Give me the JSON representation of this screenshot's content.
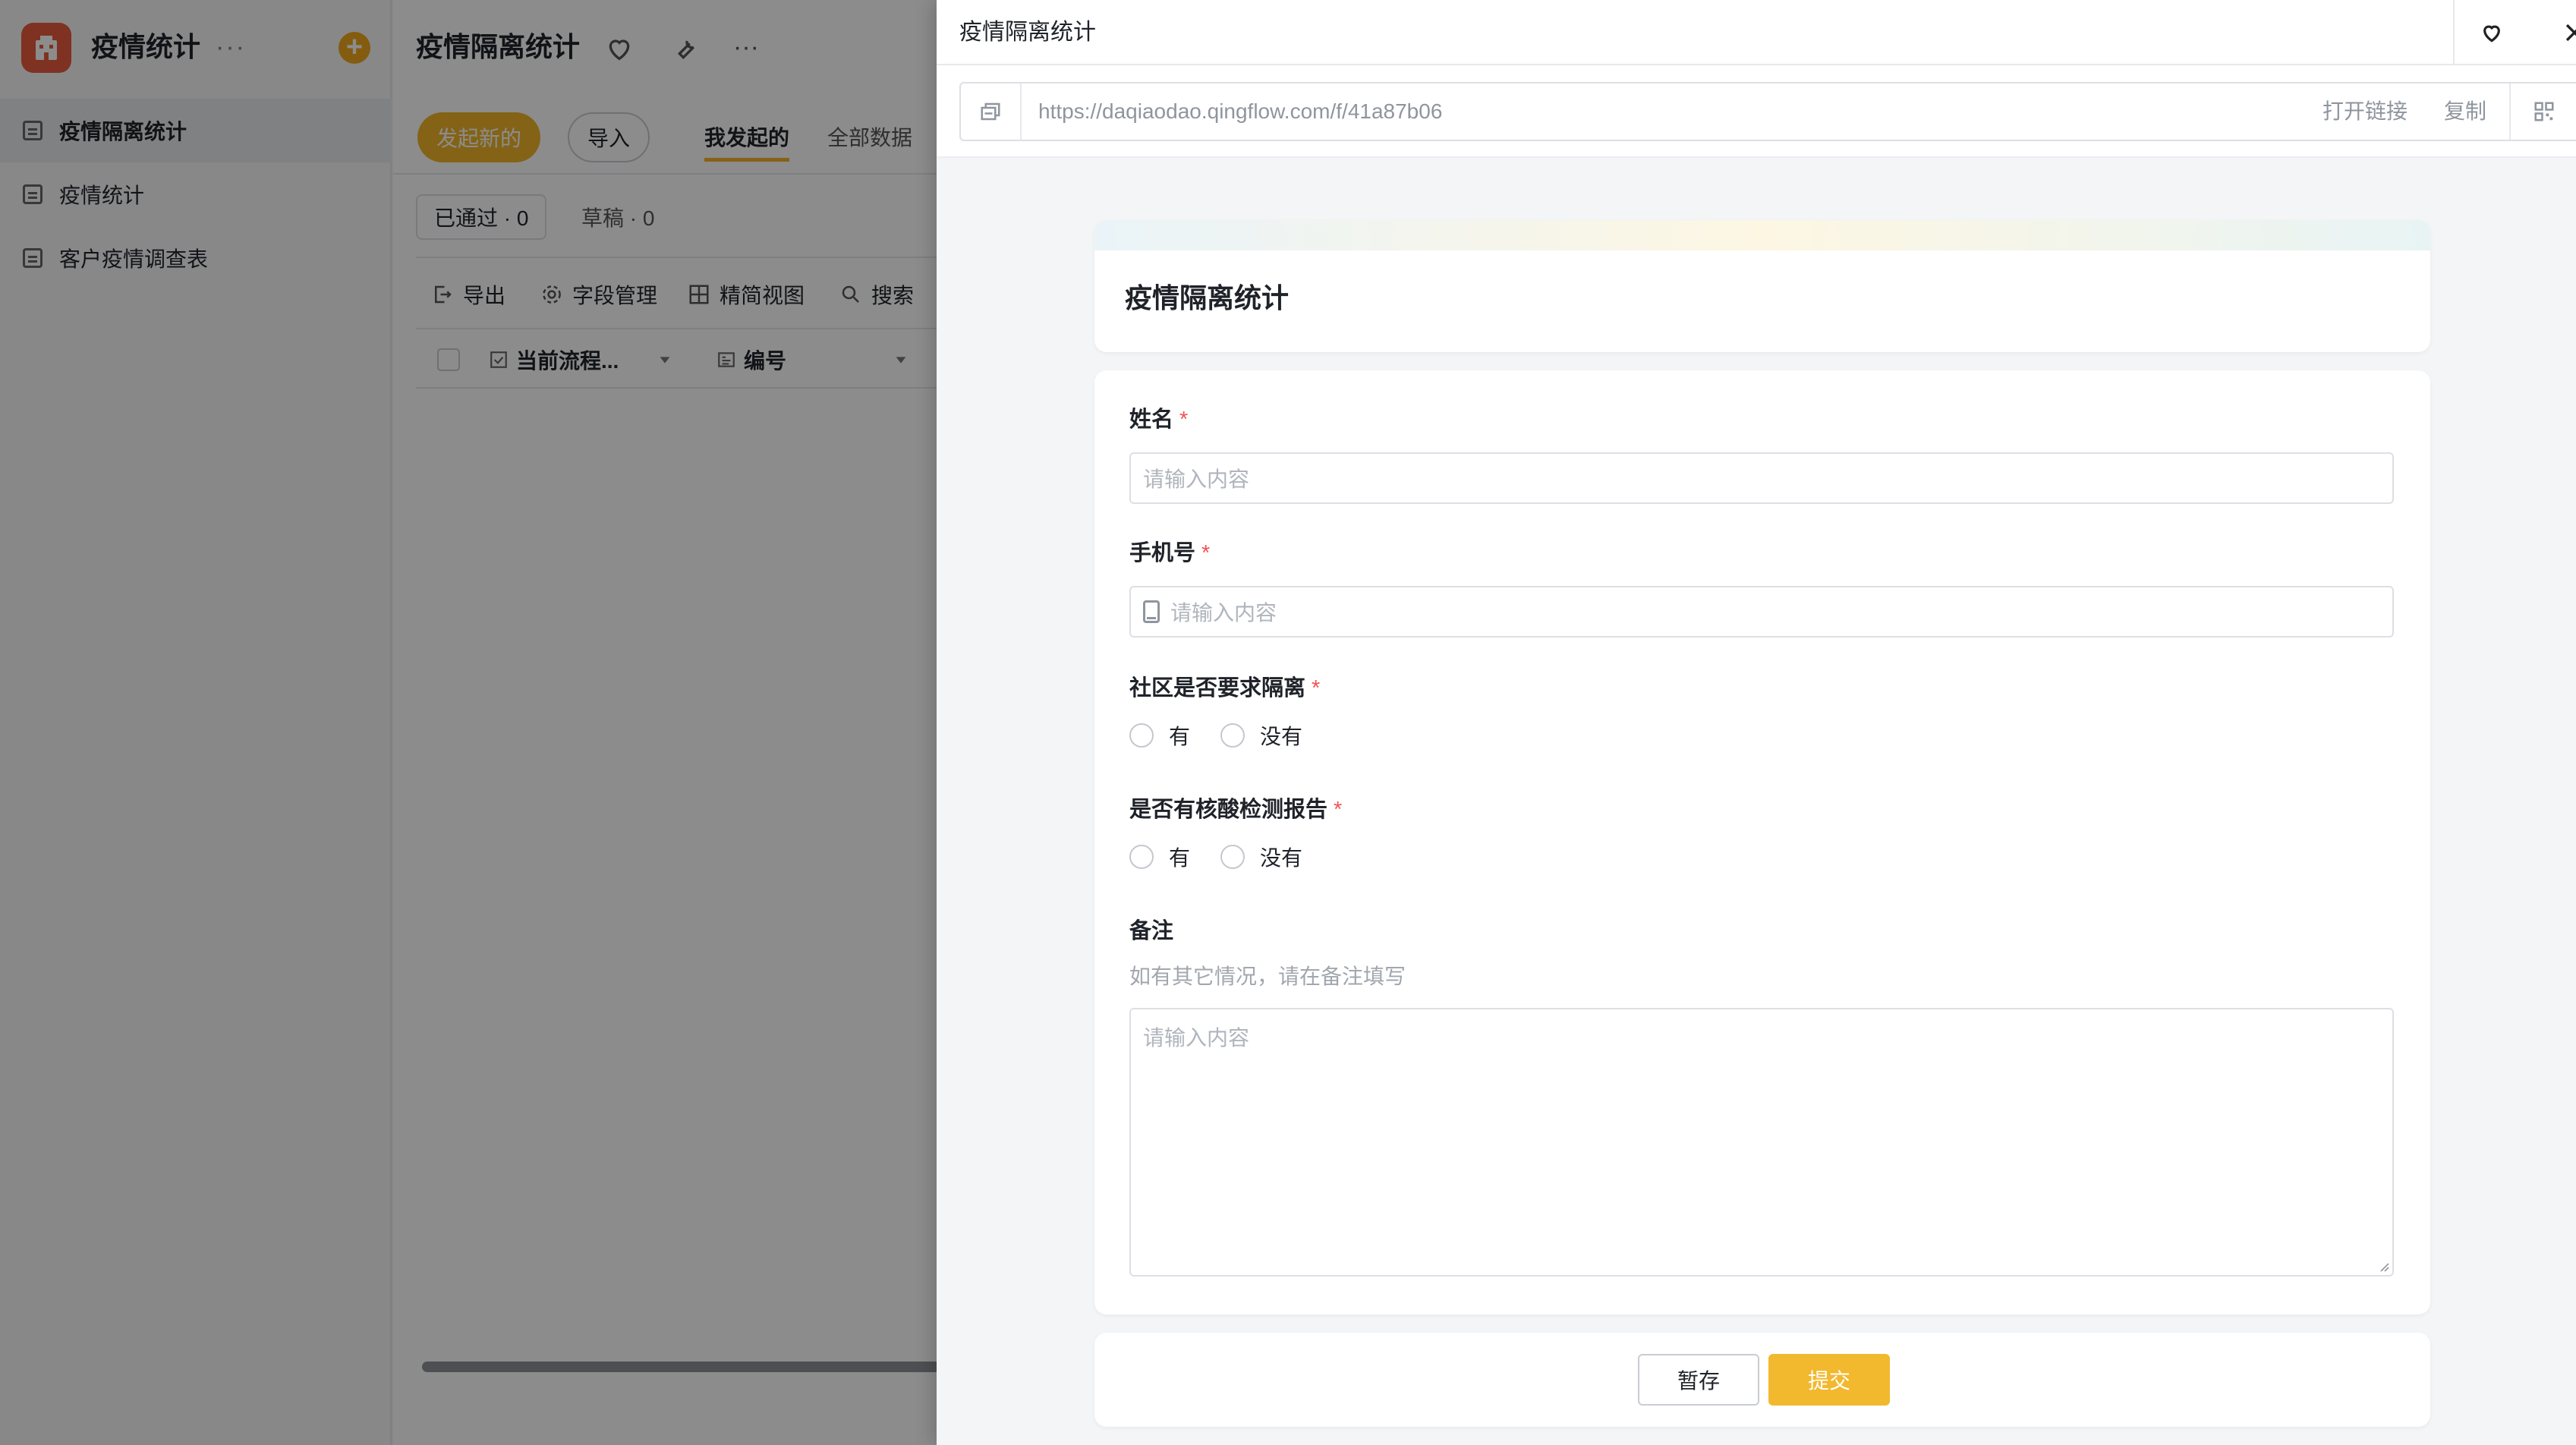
{
  "app": {
    "name": "疫情统计",
    "more": "···",
    "add": "+"
  },
  "sidebar": {
    "items": [
      {
        "label": "疫情隔离统计"
      },
      {
        "label": "疫情统计"
      },
      {
        "label": "客户疫情调查表"
      }
    ]
  },
  "main": {
    "title": "疫情隔离统计",
    "new_label": "发起新的",
    "import_label": "导入",
    "tabs": [
      {
        "label": "我发起的"
      },
      {
        "label": "全部数据"
      }
    ],
    "chips": [
      {
        "label": "已通过 · 0"
      },
      {
        "label": "草稿 · 0"
      }
    ],
    "toolbar": [
      {
        "label": "导出"
      },
      {
        "label": "字段管理"
      },
      {
        "label": "精简视图"
      },
      {
        "label": "搜索"
      }
    ],
    "columns": [
      {
        "label": "当前流程..."
      },
      {
        "label": "编号"
      }
    ]
  },
  "drawer": {
    "title": "疫情隔离统计",
    "url": "https://daqiaodao.qingflow.com/f/41a87b06",
    "open_link": "打开链接",
    "copy": "复制",
    "form": {
      "title": "疫情隔离统计",
      "fields": {
        "name": {
          "label": "姓名",
          "required": "*",
          "placeholder": "请输入内容"
        },
        "phone": {
          "label": "手机号",
          "required": "*",
          "placeholder": "请输入内容"
        },
        "community": {
          "label": "社区是否要求隔离",
          "required": "*",
          "options": [
            "有",
            "没有"
          ]
        },
        "nucleic": {
          "label": "是否有核酸检测报告",
          "required": "*",
          "options": [
            "有",
            "没有"
          ]
        },
        "remark": {
          "label": "备注",
          "hint": "如有其它情况，请在备注填写",
          "placeholder": "请输入内容"
        }
      },
      "save_label": "暂存",
      "submit_label": "提交"
    }
  },
  "colors": {
    "accent": "#f2b82e",
    "required": "#f05454",
    "logo": "#e85b3f"
  }
}
